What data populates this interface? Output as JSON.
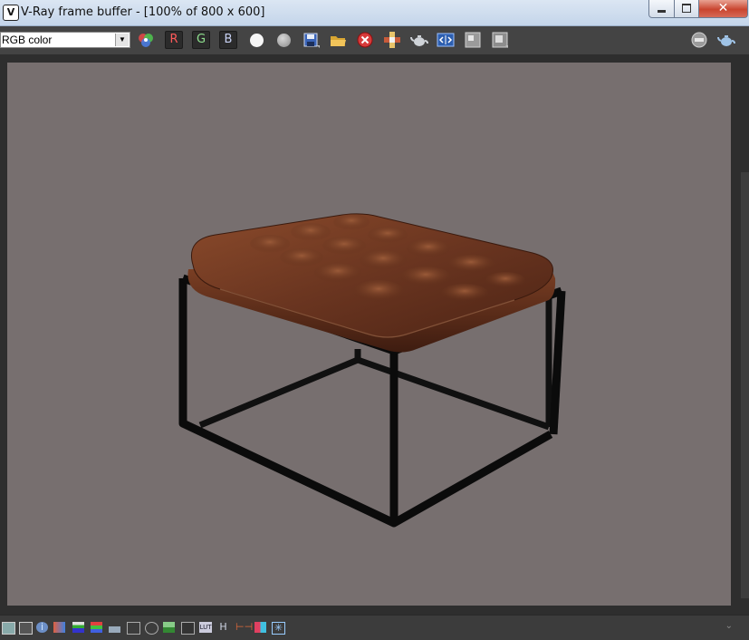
{
  "window": {
    "title": "V-Ray frame buffer - [100% of 800 x 600]",
    "app_icon_glyph": "V",
    "close_glyph": "✕"
  },
  "toolbar": {
    "channel_value": "RGB color",
    "red_label": "R",
    "green_label": "G",
    "blue_label": "B",
    "icons": [
      "color-channels-icon",
      "red-channel-button",
      "green-channel-button",
      "blue-channel-button",
      "display-white-icon",
      "display-mono-icon",
      "save-image-icon",
      "open-folder-icon",
      "clear-image-icon",
      "track-mouse-icon",
      "render-teapot-icon",
      "compare-icon",
      "region-icon",
      "region-render-icon",
      "stamp-icon",
      "interactive-teapot-icon"
    ]
  },
  "statusbar": {
    "icons": [
      "frame-icon",
      "history-icon",
      "info-icon",
      "lut-icon",
      "ocio-icon",
      "levels-icon",
      "histogram-icon",
      "curves-icon",
      "target-icon",
      "background-icon",
      "exposure-icon",
      "lut-file-icon",
      "hsv-icon",
      "stereo-icon",
      "split-icon",
      "options-icon"
    ],
    "lut_label": "LUT",
    "h_label": "H"
  },
  "colors": {
    "render_background": "#776f6f",
    "toolbar_background": "#444444",
    "frame_background": "#2e2e2e"
  }
}
